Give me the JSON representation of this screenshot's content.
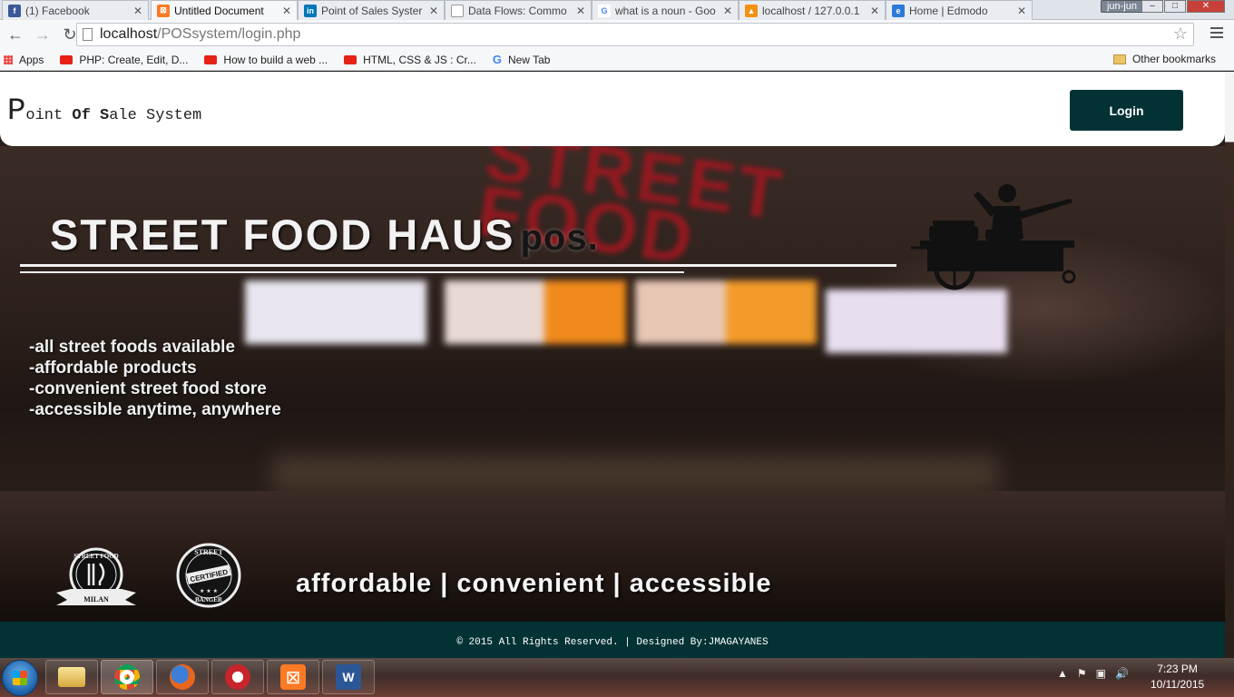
{
  "browser": {
    "tabs": [
      {
        "label": "(1) Facebook",
        "icon": "facebook-icon",
        "color": "#3b5998",
        "active": false
      },
      {
        "label": "Untitled Document",
        "icon": "xampp-icon",
        "color": "#fb7a24",
        "active": true
      },
      {
        "label": "Point of Sales Syster",
        "icon": "linkedin-icon",
        "color": "#0077b5",
        "active": false
      },
      {
        "label": "Data Flows: Commo",
        "icon": "page-icon",
        "color": "#cccccc",
        "active": false
      },
      {
        "label": "what is a noun - Goo",
        "icon": "google-icon",
        "color": "#4285f4",
        "active": false
      },
      {
        "label": "localhost / 127.0.0.1",
        "icon": "phpmyadmin-icon",
        "color": "#f29111",
        "active": false
      },
      {
        "label": "Home | Edmodo",
        "icon": "edmodo-icon",
        "color": "#2c7ad6",
        "active": false
      }
    ],
    "user": "jun-jun",
    "url_host": "localhost",
    "url_path": "/POSsystem/login.php",
    "bookmarks": [
      {
        "label": "Apps",
        "icon": "apps-icon"
      },
      {
        "label": "PHP: Create, Edit, D...",
        "icon": "youtube-icon"
      },
      {
        "label": "How to build a web ...",
        "icon": "youtube-icon"
      },
      {
        "label": "HTML, CSS & JS : Cr...",
        "icon": "youtube-icon"
      },
      {
        "label": "New Tab",
        "icon": "google-icon"
      }
    ],
    "other_bookmarks": "Other bookmarks"
  },
  "navbar": {
    "brand_first": "P",
    "brand_rest_1": "oint ",
    "brand_of": "Of",
    "brand_s": " S",
    "brand_rest_2": "ale System",
    "login_label": "Login"
  },
  "hero": {
    "title": "STREET FOOD HAUS",
    "title_suffix": "pos.",
    "features": [
      "-all street foods available",
      "-affordable products",
      "-convenient street food store",
      "-accessible anytime, anywhere"
    ],
    "badge_1_top": "STREET FOOD",
    "badge_1_bottom": "MILAN",
    "badge_2_top": "STREET",
    "badge_2_mid": "CERTIFIED",
    "badge_2_bottom": "BANGER",
    "tagline": "affordable | convenient | accessible"
  },
  "footer": {
    "text": "© 2015 All Rights Reserved. | Designed By:JMAGAYANES"
  },
  "taskbar": {
    "clock_time": "7:23 PM",
    "clock_date": "10/11/2015"
  },
  "colors": {
    "accent": "#033235",
    "sign_red": "#a11720"
  }
}
